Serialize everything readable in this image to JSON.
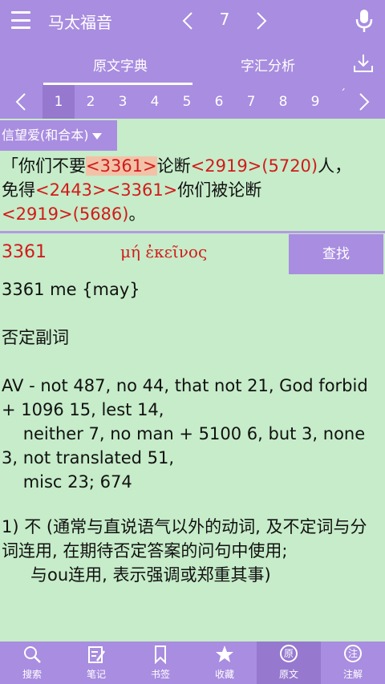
{
  "header": {
    "book_title": "马太福音",
    "chapter": "7"
  },
  "tabs": [
    {
      "label": "原文字典"
    },
    {
      "label": "字汇分析"
    }
  ],
  "verse_numbers": [
    "1",
    "2",
    "3",
    "4",
    "5",
    "6",
    "7",
    "8",
    "9"
  ],
  "verse_tick": "ˊ",
  "version_label": "信望爱(和合本)",
  "verse": {
    "open_quote": "「",
    "t1": "你们不要",
    "r1": "<3361>",
    "t2": "论断",
    "r2": "<2919>",
    "r3": "(5720)",
    "t3": "人，",
    "t4": "免得",
    "r4": "<2443>",
    "r5": "<3361>",
    "t5": "你们被论断",
    "r6": "<2919>",
    "r7": "(5686)",
    "t6": "。"
  },
  "lexicon": {
    "number": "3361",
    "greek": "μή ἐκεῖνος",
    "find_label": "查找",
    "line1": "3361 me {may}",
    "line2": "否定副词",
    "line3": "AV - not 487, no 44, that not 21, God forbid",
    "line4": "+ 1096 15, lest 14,",
    "line5": "    neither 7, no man + 5100 6, but 3, none",
    "line6": "3, not translated 51,",
    "line7": "    misc 23; 674",
    "def1": "1) 不 (通常与直说语气以外的动词, 及不定词与分词连用, 在期待否定答案的问句中使用;",
    "def2": "与ou连用, 表示强调或郑重其事)"
  },
  "bottom_nav": [
    {
      "label": "搜索",
      "icon": "search-icon"
    },
    {
      "label": "笔记",
      "icon": "note-icon"
    },
    {
      "label": "书签",
      "icon": "bookmark-icon"
    },
    {
      "label": "收藏",
      "icon": "star-icon"
    },
    {
      "label": "原文",
      "icon": "original-icon",
      "glyph": "原"
    },
    {
      "label": "注解",
      "icon": "annotation-icon",
      "glyph": "注"
    }
  ],
  "colors": {
    "accent": "#a98de0",
    "background": "#c6ecc9",
    "reference_red": "#d21b1b"
  }
}
